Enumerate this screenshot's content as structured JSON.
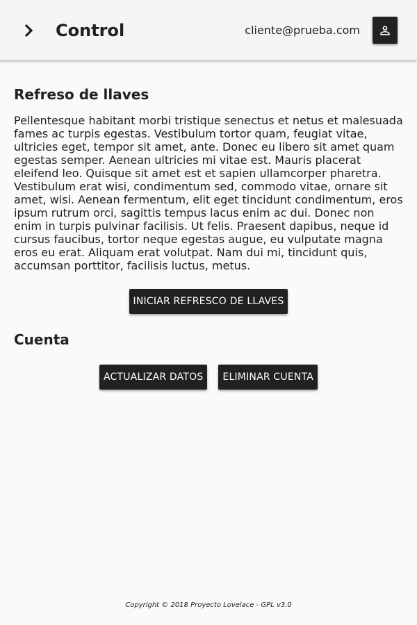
{
  "header": {
    "title": "Control",
    "user_email": "cliente@prueba.com",
    "menu_icon": "chevron-right-icon",
    "account_icon": "person-icon"
  },
  "keys_section": {
    "title": "Refreso de llaves",
    "description": "Pellentesque habitant morbi tristique senectus et netus et malesuada fames ac turpis egestas. Vestibulum tortor quam, feugiat vitae, ultricies eget, tempor sit amet, ante. Donec eu libero sit amet quam egestas semper. Aenean ultricies mi vitae est. Mauris placerat eleifend leo. Quisque sit amet est et sapien ullamcorper pharetra. Vestibulum erat wisi, condimentum sed, commodo vitae, ornare sit amet, wisi. Aenean fermentum, elit eget tincidunt condimentum, eros ipsum rutrum orci, sagittis tempus lacus enim ac dui. Donec non enim in turpis pulvinar facilisis. Ut felis. Praesent dapibus, neque id cursus faucibus, tortor neque egestas augue, eu vulputate magna eros eu erat. Aliquam erat volutpat. Nam dui mi, tincidunt quis, accumsan porttitor, facilisis luctus, metus.",
    "start_button": "INICIAR REFRESCO DE LLAVES"
  },
  "account_section": {
    "title": "Cuenta",
    "update_button": "ACTUALIZAR DATOS",
    "delete_button": "ELIMINAR CUENTA"
  },
  "footer": {
    "copyright": "Copyright © 2018 Proyecto Lovelace - GPL v3.0"
  },
  "colors": {
    "button_bg": "#212121",
    "button_text": "#ffffff",
    "page_bg": "#fafafa",
    "header_bg": "#f5f5f5"
  }
}
